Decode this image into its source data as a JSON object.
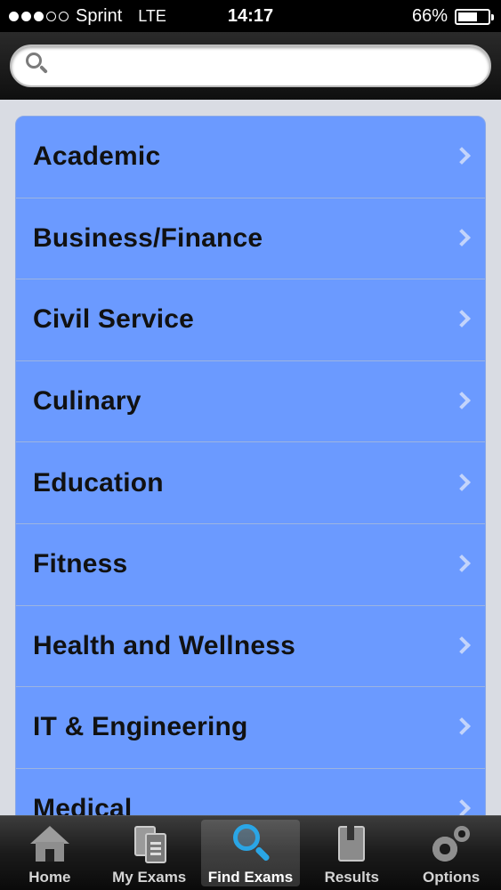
{
  "status_bar": {
    "carrier": "Sprint",
    "network": "LTE",
    "time": "14:17",
    "battery_percent": "66%",
    "battery_level": 0.66,
    "signal_bars_filled": 3,
    "signal_bars_total": 5
  },
  "search": {
    "value": "",
    "placeholder": ""
  },
  "categories": [
    {
      "label": "Academic"
    },
    {
      "label": "Business/Finance"
    },
    {
      "label": "Civil Service"
    },
    {
      "label": "Culinary"
    },
    {
      "label": "Education"
    },
    {
      "label": "Fitness"
    },
    {
      "label": "Health and Wellness"
    },
    {
      "label": "IT & Engineering"
    },
    {
      "label": "Medical"
    }
  ],
  "tab_bar": {
    "tabs": [
      {
        "label": "Home",
        "icon": "home-icon"
      },
      {
        "label": "My Exams",
        "icon": "documents-icon"
      },
      {
        "label": "Find Exams",
        "icon": "magnifier-icon",
        "active": true
      },
      {
        "label": "Results",
        "icon": "book-icon"
      },
      {
        "label": "Options",
        "icon": "gears-icon"
      }
    ]
  },
  "colors": {
    "list_background": "#6b9aff",
    "page_background": "#d9dce3",
    "active_icon": "#2aa6e6"
  }
}
